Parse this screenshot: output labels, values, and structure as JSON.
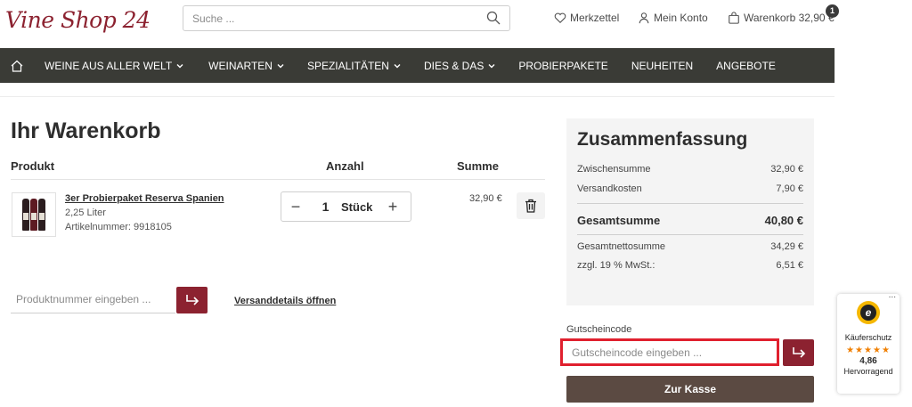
{
  "header": {
    "logo": "Vine Shop 24",
    "search_placeholder": "Suche ...",
    "wishlist": "Merkzettel",
    "account": "Mein Konto",
    "cart": "Warenkorb 32,90 €",
    "cart_count": "1"
  },
  "nav": {
    "items": [
      {
        "label": "WEINE AUS ALLER WELT",
        "dropdown": true
      },
      {
        "label": "WEINARTEN",
        "dropdown": true
      },
      {
        "label": "SPEZIALITÄTEN",
        "dropdown": true
      },
      {
        "label": "DIES & DAS",
        "dropdown": true
      },
      {
        "label": "PROBIERPAKETE",
        "dropdown": false
      },
      {
        "label": "NEUHEITEN",
        "dropdown": false
      },
      {
        "label": "ANGEBOTE",
        "dropdown": false
      }
    ]
  },
  "cart": {
    "title": "Ihr Warenkorb",
    "col_product": "Produkt",
    "col_qty": "Anzahl",
    "col_sum": "Summe",
    "item": {
      "name": "3er Probierpaket Reserva Spanien",
      "volume": "2,25 Liter",
      "article_no": "Artikelnummer: 9918105",
      "qty": "1",
      "unit": "Stück",
      "price": "32,90 €"
    },
    "product_number_placeholder": "Produktnummer eingeben ...",
    "shipping_link": "Versanddetails öffnen"
  },
  "summary": {
    "title": "Zusammenfassung",
    "subtotal_label": "Zwischensumme",
    "subtotal": "32,90 €",
    "shipping_label": "Versandkosten",
    "shipping": "7,90 €",
    "total_label": "Gesamtsumme",
    "total": "40,80 €",
    "net_label": "Gesamtnettosumme",
    "net": "34,29 €",
    "vat_label": "zzgl. 19 % MwSt.:",
    "vat": "6,51 €",
    "voucher_label": "Gutscheincode",
    "voucher_placeholder": "Gutscheincode eingeben ...",
    "checkout": "Zur Kasse"
  },
  "trust": {
    "seal_letter": "e",
    "label": "Käuferschutz",
    "stars": "★★★★★",
    "score": "4,86",
    "rating": "Hervorragend",
    "menu": "..."
  },
  "colors": {
    "brand": "#8c2230",
    "nav_bg": "#3a3b36",
    "checkout_bg": "#5b4a42",
    "highlight": "#e0202e"
  }
}
